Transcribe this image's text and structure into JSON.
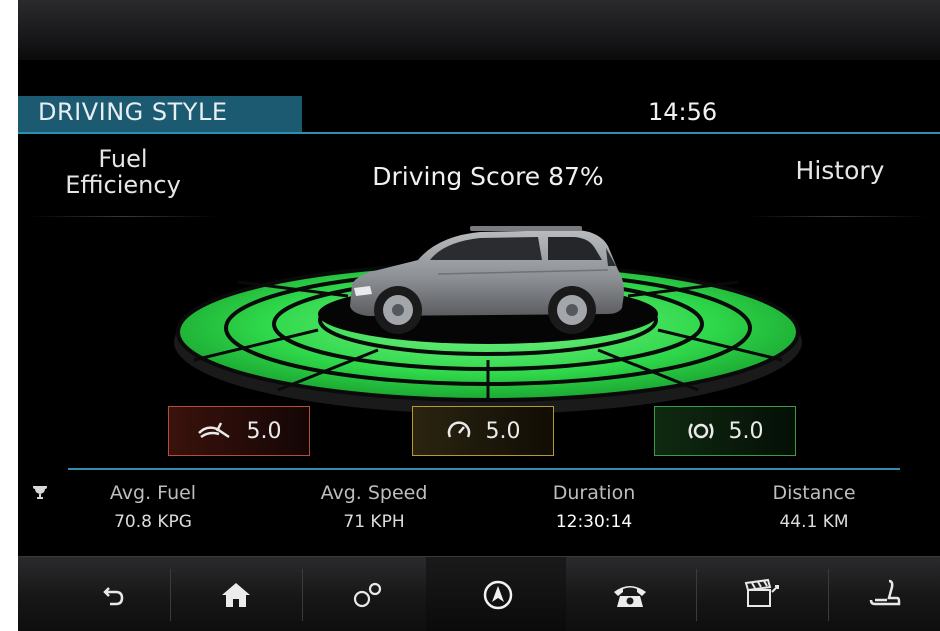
{
  "header": {
    "title": "DRIVING STYLE",
    "clock": "14:56"
  },
  "subheader": {
    "left": "Fuel Efficiency",
    "left_line1": "Fuel",
    "left_line2": "Efficiency",
    "center": "Driving Score 87%",
    "right": "History"
  },
  "scores": [
    {
      "icon": "braking-icon",
      "value": "5.0",
      "color": "#b0503a"
    },
    {
      "icon": "speedometer-icon",
      "value": "5.0",
      "color": "#b79a2e"
    },
    {
      "icon": "steering-icon",
      "value": "5.0",
      "color": "#3f9a46"
    }
  ],
  "stats": [
    {
      "label": "Avg. Fuel",
      "value": "70.8 KPG"
    },
    {
      "label": "Avg. Speed",
      "value": "71 KPH"
    },
    {
      "label": "Duration",
      "value": "12:30:14"
    },
    {
      "label": "Distance",
      "value": "44.1 KM"
    }
  ],
  "nav": [
    {
      "icon": "back-icon"
    },
    {
      "icon": "home-icon"
    },
    {
      "icon": "settings-icon"
    },
    {
      "icon": "navigation-icon",
      "active": true
    },
    {
      "icon": "phone-icon"
    },
    {
      "icon": "media-icon"
    },
    {
      "icon": "seat-icon"
    }
  ],
  "colors": {
    "accent_blue": "#2e8fb0",
    "header_tab": "#1b5a70",
    "ring_green": "#2fd84a"
  }
}
